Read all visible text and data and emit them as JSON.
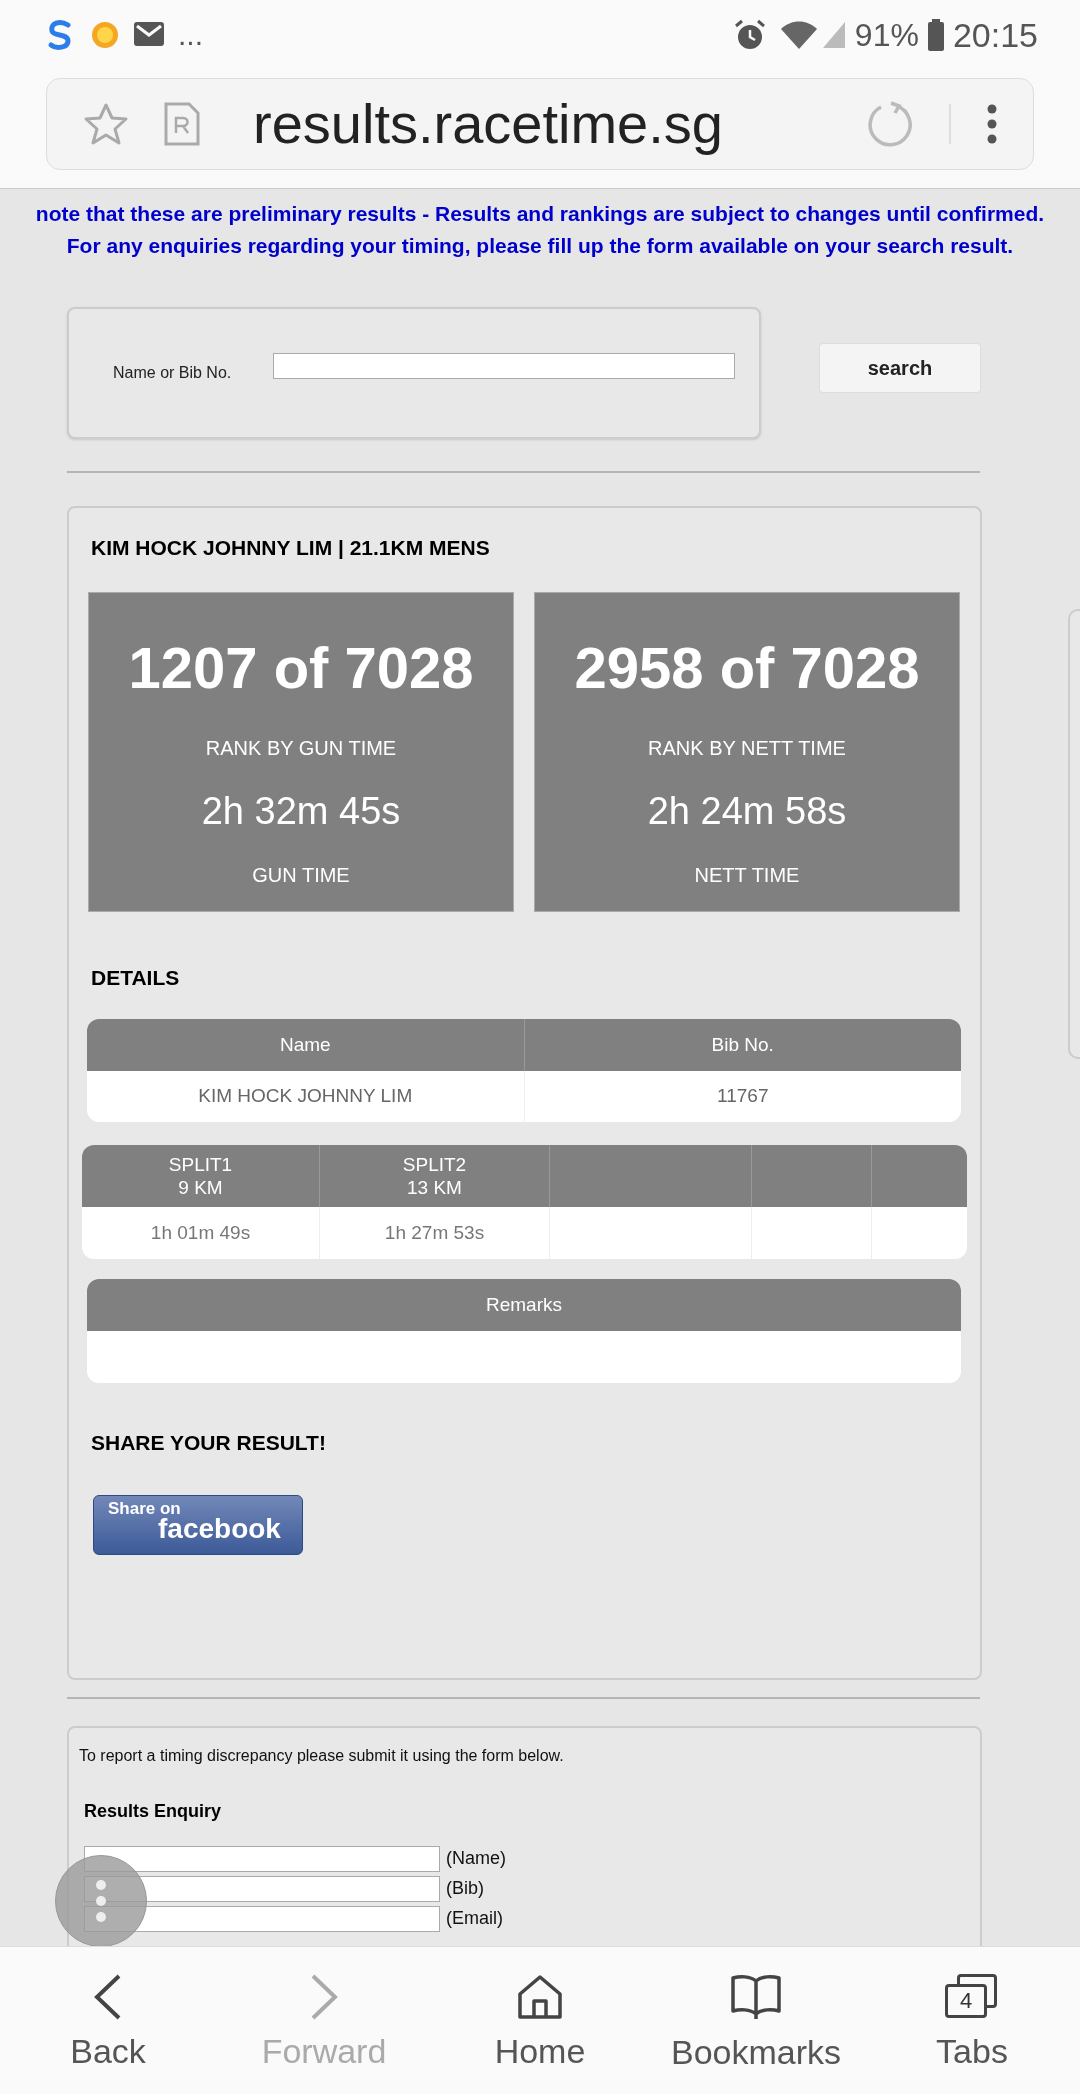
{
  "status_bar": {
    "overflow": "...",
    "battery": "91%",
    "time": "20:15"
  },
  "address_bar": {
    "url": "results.racetime.sg"
  },
  "notice": {
    "lines": [
      "note that these are preliminary results - Results and rankings are subject to changes until confirmed.",
      "For any enquiries regarding your timing, please fill up the form available on your search result."
    ]
  },
  "search": {
    "label": "Name or Bib No.",
    "button": "search"
  },
  "result": {
    "title": "KIM HOCK JOHNNY LIM | 21.1KM MENS",
    "ranks": [
      {
        "rank": "1207 of 7028",
        "rank_label": "RANK BY GUN TIME",
        "time": "2h 32m 45s",
        "time_label": "GUN TIME"
      },
      {
        "rank": "2958 of 7028",
        "rank_label": "RANK BY NETT TIME",
        "time": "2h 24m 58s",
        "time_label": "NETT TIME"
      }
    ],
    "details_heading": "DETAILS",
    "details_table": {
      "columns": [
        "Name",
        "Bib No."
      ],
      "row": [
        "KIM HOCK JOHNNY LIM",
        "11767"
      ]
    },
    "splits": [
      {
        "lines": [
          "SPLIT1",
          "9 KM"
        ],
        "value": "1h 01m 49s"
      },
      {
        "lines": [
          "SPLIT2",
          "13 KM"
        ],
        "value": "1h 27m 53s"
      }
    ],
    "remarks_heading": "Remarks",
    "share_heading": "SHARE YOUR RESULT!",
    "share_button": {
      "line1": "Share on",
      "line2": "facebook"
    }
  },
  "enquiry": {
    "intro": "To report a timing discrepancy please submit it using the form below.",
    "heading": "Results Enquiry",
    "fields": [
      {
        "label": "(Name)"
      },
      {
        "label": "(Bib)"
      },
      {
        "label": "(Email)"
      }
    ]
  },
  "bottom_nav": [
    {
      "kind": "back",
      "label": "Back",
      "disabled": false
    },
    {
      "kind": "forward",
      "label": "Forward",
      "disabled": true
    },
    {
      "kind": "home",
      "label": "Home",
      "disabled": false
    },
    {
      "kind": "bookmarks",
      "label": "Bookmarks",
      "disabled": false
    },
    {
      "kind": "tabs",
      "label": "Tabs",
      "count": "4",
      "disabled": false
    }
  ]
}
